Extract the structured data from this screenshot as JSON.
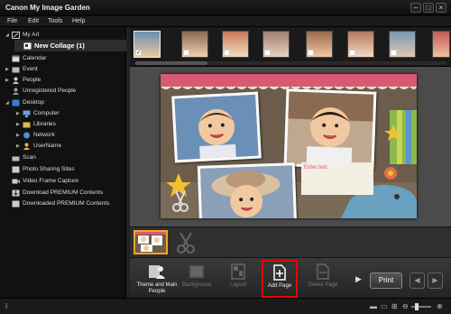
{
  "app": {
    "title": "Canon My Image Garden"
  },
  "menu": [
    "File",
    "Edit",
    "Tools",
    "Help"
  ],
  "sidebar": {
    "items": [
      {
        "label": "My Art",
        "expanded": true
      },
      {
        "label": "New Collage (1)",
        "selected": true
      },
      {
        "label": "Calendar"
      },
      {
        "label": "Event"
      },
      {
        "label": "People"
      },
      {
        "label": "Unregistered People"
      },
      {
        "label": "Desktop",
        "expanded": true
      },
      {
        "label": "Computer"
      },
      {
        "label": "Libraries"
      },
      {
        "label": "Network"
      },
      {
        "label": "UserName"
      },
      {
        "label": "Scan"
      },
      {
        "label": "Photo Sharing Sites"
      },
      {
        "label": "Video Frame Capture"
      },
      {
        "label": "Download PREMIUM Contents"
      },
      {
        "label": "Downloaded PREMIUM Contents"
      }
    ]
  },
  "canvas": {
    "text_placeholder": "Enter text."
  },
  "toolbar": {
    "theme_label": "Theme and Main People",
    "background_label": "Background",
    "layout_label": "Layout",
    "add_page_label": "Add Page",
    "delete_page_label": "Delete Page",
    "print_label": "Print"
  },
  "colors": {
    "highlight": "#e00000",
    "page_thumb_border": "#f5a623"
  }
}
